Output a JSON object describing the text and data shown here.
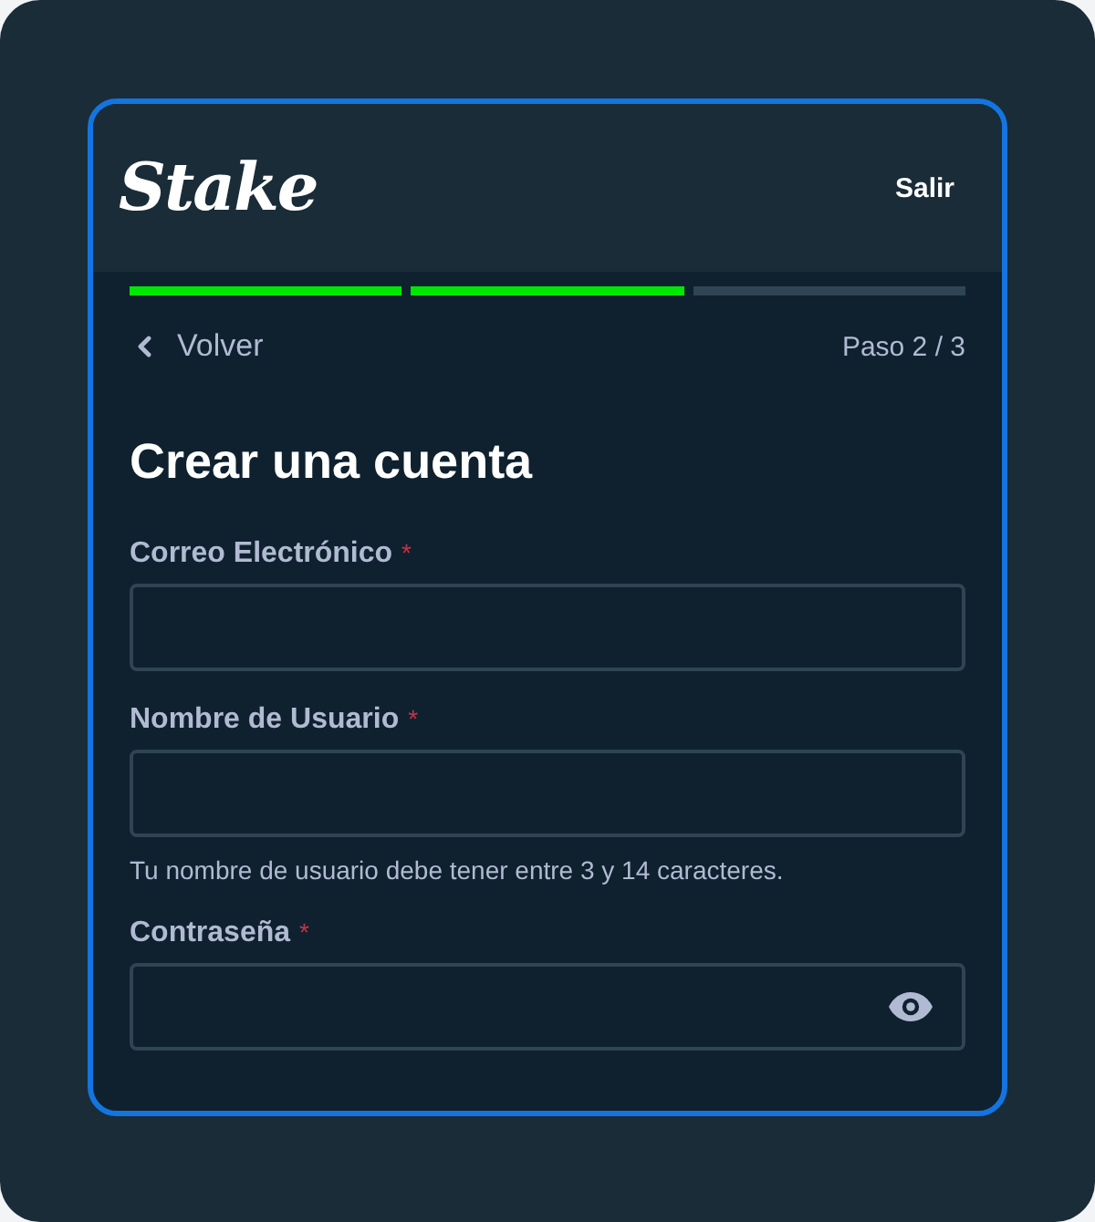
{
  "header": {
    "logo": "Stake",
    "exit_button": "Salir"
  },
  "progress": [
    {
      "done": true
    },
    {
      "done": true
    },
    {
      "done": false
    }
  ],
  "nav": {
    "back": "Volver",
    "step": "Paso 2 / 3"
  },
  "title": "Crear una cuenta",
  "fields": [
    {
      "kind": "text",
      "label": "Correo Electrónico",
      "required": "*"
    },
    {
      "kind": "text",
      "label": "Nombre de Usuario",
      "required": "*",
      "hint": "Tu nombre de usuario debe tener entre 3 y 14 caracteres."
    },
    {
      "kind": "password",
      "label": "Contraseña",
      "required": "*"
    }
  ]
}
